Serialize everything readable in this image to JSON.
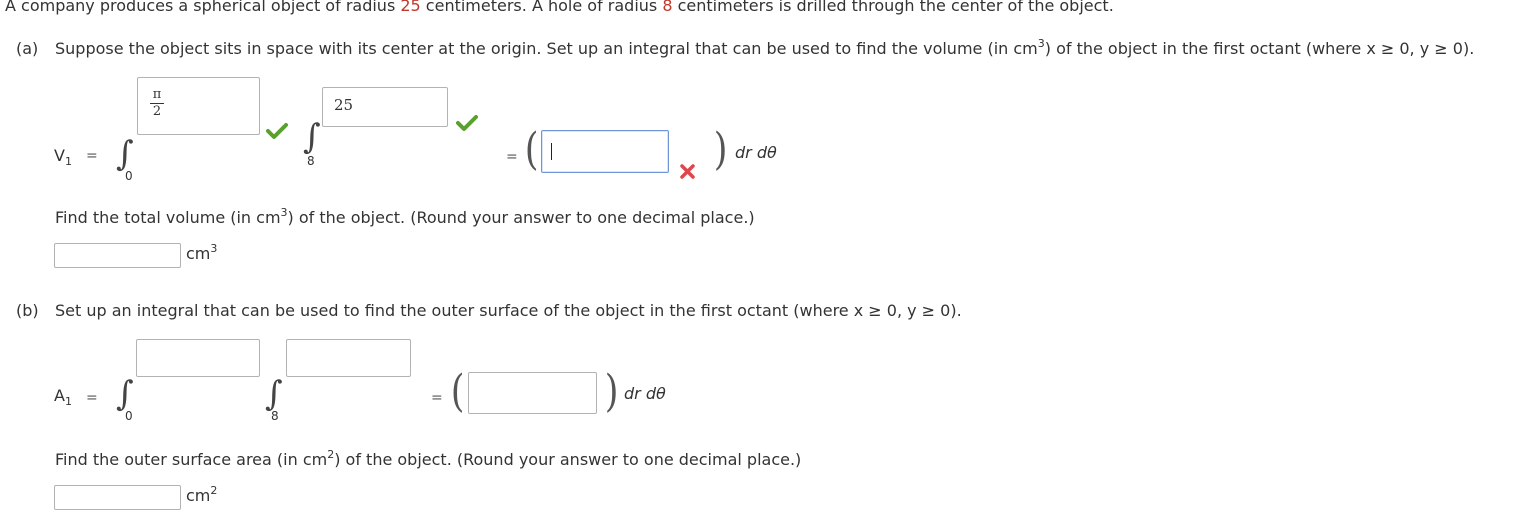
{
  "problem": {
    "intro_part1": "A company produces a spherical object of radius ",
    "radius_outer": "25",
    "intro_part2": " centimeters. A hole of radius ",
    "radius_hole": "8",
    "intro_part3": " centimeters is drilled through the center of the object."
  },
  "part_a": {
    "label": "(a)",
    "prompt_part1": "Suppose the object sits in space with its center at the origin. Set up an integral that can be used to find the volume (in cm",
    "prompt_sup": "3",
    "prompt_part2": ") of the object in the first octant (where x ≥ 0, y ≥ 0).",
    "var_name": "V",
    "var_sub": "1",
    "equals": "=",
    "outer_lower": "0",
    "outer_upper_num": "π",
    "outer_upper_den": "2",
    "inner_lower": "8",
    "inner_upper": "25",
    "integrand_value": "",
    "differentials": "dr dθ",
    "followup_part1": "Find the total volume (in cm",
    "followup_sup": "3",
    "followup_part2": ") of the object. (Round your answer to one decimal place.)",
    "answer_value": "",
    "answer_unit": "cm",
    "answer_unit_sup": "3"
  },
  "part_b": {
    "label": "(b)",
    "prompt": "Set up an integral that can be used to find the outer surface of the object in the first octant (where x ≥ 0, y ≥ 0).",
    "var_name": "A",
    "var_sub": "1",
    "equals": "=",
    "outer_lower": "0",
    "outer_upper": "",
    "inner_lower": "8",
    "inner_upper": "",
    "integrand_value": "",
    "differentials": "dr dθ",
    "followup_part1": "Find the outer surface area (in cm",
    "followup_sup": "2",
    "followup_part2": ") of the object. (Round your answer to one decimal place.)",
    "answer_value": "",
    "answer_unit": "cm",
    "answer_unit_sup": "2"
  },
  "colors": {
    "highlight_red": "#c0392b",
    "check_green": "#5aa02c",
    "cross_red": "#e0474c"
  }
}
